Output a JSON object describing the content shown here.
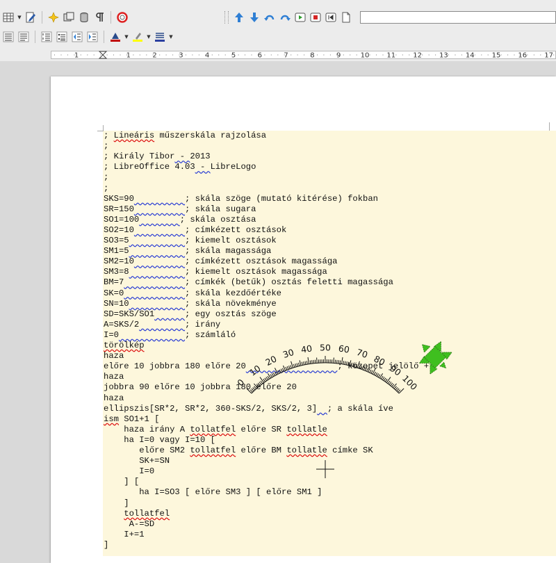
{
  "toolbar": {
    "row1_icons": [
      "table-icon",
      "table-dropdown",
      "edit-document-icon",
      "navigator-star-icon",
      "gallery-icon",
      "data-sources-icon",
      "formatting-marks-icon",
      "help-lifebuoy-icon"
    ],
    "logo_toolbar_icons": [
      "arrow-up-icon",
      "arrow-down-icon",
      "rotate-left-icon",
      "rotate-right-icon",
      "run-icon",
      "stop-icon",
      "home-icon",
      "clear-screen-icon"
    ],
    "row2_icons": [
      "align-justify-icon",
      "align-center-justify-icon",
      "numbering-icon",
      "bullets-icon",
      "decrease-indent-icon",
      "increase-indent-icon",
      "font-color-icon",
      "highlighting-icon",
      "background-color-icon"
    ],
    "command_field_value": ""
  },
  "ruler": {
    "labels": [
      "1",
      "1",
      "2",
      "3",
      "4",
      "5",
      "6",
      "7",
      "8",
      "9",
      "10",
      "11",
      "12",
      "13",
      "14",
      "15",
      "16",
      "17"
    ]
  },
  "code_lines": [
    [
      {
        "t": "; "
      },
      {
        "t": "Lineáris",
        "s": "sq"
      },
      {
        "t": " műszerskála rajzolása"
      }
    ],
    [
      {
        "t": ";"
      }
    ],
    [
      {
        "t": "; Király Tibor"
      },
      {
        "t": " - ",
        "s": "wv"
      },
      {
        "t": "2013"
      }
    ],
    [
      {
        "t": "; LibreOffice 4.03"
      },
      {
        "t": " - ",
        "s": "wv"
      },
      {
        "t": "LibreLogo"
      }
    ],
    [
      {
        "t": ";"
      }
    ],
    [
      {
        "t": ";"
      }
    ],
    [
      {
        "t": "SKS=90"
      },
      {
        "t": "          ",
        "s": "wv"
      },
      {
        "t": "; skála szöge (mutató kitérése) fokban"
      }
    ],
    [
      {
        "t": "SR=150"
      },
      {
        "t": "          ",
        "s": "wv"
      },
      {
        "t": "; skála sugara"
      }
    ],
    [
      {
        "t": "SO1=100"
      },
      {
        "t": "        ",
        "s": "wv"
      },
      {
        "t": "; skála osztása"
      }
    ],
    [
      {
        "t": "SO2=10"
      },
      {
        "t": "          ",
        "s": "wv"
      },
      {
        "t": "; címkézett osztások"
      }
    ],
    [
      {
        "t": "SO3=5"
      },
      {
        "t": "           ",
        "s": "wv"
      },
      {
        "t": "; kiemelt osztások"
      }
    ],
    [
      {
        "t": "SM1=5"
      },
      {
        "t": "           ",
        "s": "wv"
      },
      {
        "t": "; skála magassága"
      }
    ],
    [
      {
        "t": "SM2=10"
      },
      {
        "t": "          ",
        "s": "wv"
      },
      {
        "t": "; címkézett osztások magassága"
      }
    ],
    [
      {
        "t": "SM3=8"
      },
      {
        "t": "           ",
        "s": "wv"
      },
      {
        "t": "; kiemelt osztások magassága"
      }
    ],
    [
      {
        "t": "BM=7"
      },
      {
        "t": "            ",
        "s": "wv"
      },
      {
        "t": "; címkék (betűk) osztás feletti magassága"
      }
    ],
    [
      {
        "t": "SK=0"
      },
      {
        "t": "            ",
        "s": "wv"
      },
      {
        "t": "; skála kezdőértéke"
      }
    ],
    [
      {
        "t": "SN=10"
      },
      {
        "t": "           ",
        "s": "wv"
      },
      {
        "t": "; skála növekménye"
      }
    ],
    [
      {
        "t": "SD=SKS/SO1"
      },
      {
        "t": "      ",
        "s": "wv"
      },
      {
        "t": "; egy osztás szöge"
      }
    ],
    [
      {
        "t": "A=SKS/2"
      },
      {
        "t": "         ",
        "s": "wv"
      },
      {
        "t": "; irány"
      }
    ],
    [
      {
        "t": "I=0"
      },
      {
        "t": "             ",
        "s": "wv"
      },
      {
        "t": "; számláló"
      }
    ],
    [
      {
        "t": "törölkép",
        "s": "sq"
      }
    ],
    [
      {
        "t": "haza"
      }
    ],
    [
      {
        "t": "előre 10 jobbra 180 előre 20"
      },
      {
        "t": "                  ",
        "s": "wv"
      },
      {
        "t": "; közepet jelölő +"
      }
    ],
    [
      {
        "t": "haza"
      }
    ],
    [
      {
        "t": "jobbra 90 előre 10 jobbra 180 előre 20"
      }
    ],
    [
      {
        "t": "haza"
      }
    ],
    [
      {
        "t": "ellipszis[SR*2, SR*2, 360-SKS/2, SKS/2, 3]"
      },
      {
        "t": "  ",
        "s": "wv"
      },
      {
        "t": "; a skála íve"
      }
    ],
    [
      {
        "t": "ism",
        "s": "sq"
      },
      {
        "t": " SO1+1 ["
      }
    ],
    [
      {
        "t": "    haza irány A "
      },
      {
        "t": "tollatfel",
        "s": "sq"
      },
      {
        "t": " előre SR "
      },
      {
        "t": "tollatle",
        "s": "sq"
      }
    ],
    [
      {
        "t": "    ha I=0 vagy I=10 ["
      }
    ],
    [
      {
        "t": "       előre SM2 "
      },
      {
        "t": "tollatfel",
        "s": "sq"
      },
      {
        "t": " előre BM "
      },
      {
        "t": "tollatle",
        "s": "sq"
      },
      {
        "t": " címke SK"
      }
    ],
    [
      {
        "t": "       SK+=SN"
      }
    ],
    [
      {
        "t": "       I=0"
      }
    ],
    [
      {
        "t": "    ] ["
      }
    ],
    [
      {
        "t": "       ha I=SO3 [ előre SM3 ] [ előre SM1 ]"
      }
    ],
    [
      {
        "t": "    ]"
      }
    ],
    [
      {
        "t": "    "
      },
      {
        "t": "tollatfel",
        "s": "sq"
      }
    ],
    [
      {
        "t": "     A-=SD"
      }
    ],
    [
      {
        "t": "    I+=1"
      }
    ],
    [
      {
        "t": "]"
      }
    ]
  ],
  "scale": {
    "labels": [
      "0",
      "10",
      "20",
      "30",
      "40",
      "50",
      "60",
      "70",
      "80",
      "90",
      "100"
    ],
    "start_angle_deg": 45,
    "end_angle_deg": 135,
    "divisions": 100,
    "labelled_every": 10,
    "highlighted_every": 5
  },
  "turtle_color": "#3fbf1f",
  "colors": {
    "code_background": "#fdf7dc",
    "spelling_underline": "#d11111",
    "grammar_underline": "#2b3ed4"
  }
}
